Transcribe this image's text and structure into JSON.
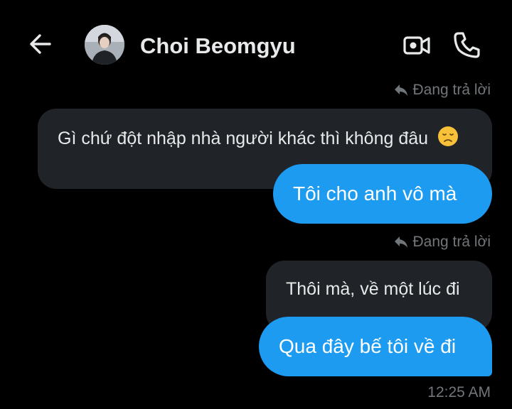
{
  "header": {
    "contact_name": "Choi Beomgyu",
    "back_icon": "arrow-left-icon",
    "video_icon": "video-camera-icon",
    "call_icon": "phone-icon",
    "avatar": "contact-avatar-photo"
  },
  "messages": [
    {
      "reply_label": "Đang trả lời",
      "quoted_text": "Gì chứ đột nhập nhà người khác thì không đâu",
      "quoted_emoji": "😞",
      "text": "Tôi cho anh vô mà"
    },
    {
      "reply_label": "Đang trả lời",
      "quoted_text": "Thôi mà, về một lúc đi",
      "text": "Qua đây bế tôi về đi"
    }
  ],
  "timestamp": "12:25 AM",
  "colors": {
    "background": "#000000",
    "outgoing_bubble": "#1d9bf0",
    "quoted_bubble": "#202327",
    "secondary_text": "#71767b"
  }
}
